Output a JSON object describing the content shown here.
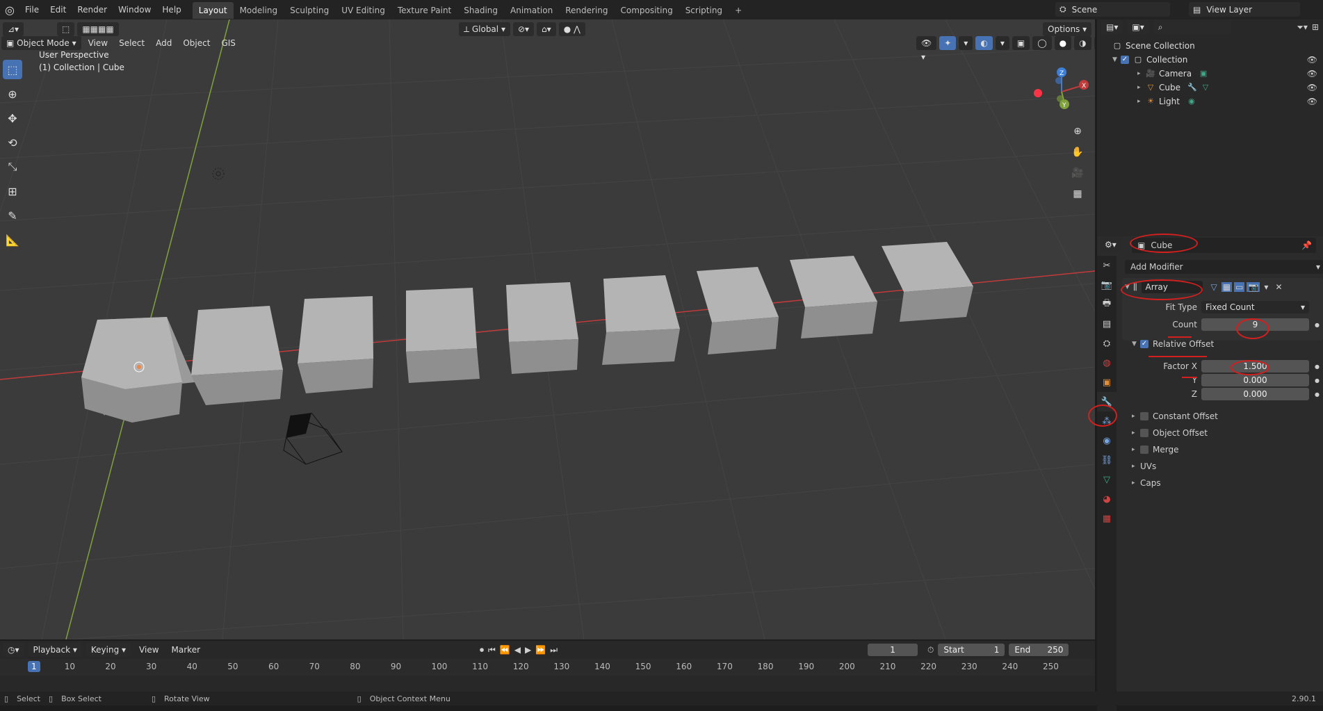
{
  "app": {
    "logo": "blender-logo-icon"
  },
  "menu": [
    "File",
    "Edit",
    "Render",
    "Window",
    "Help"
  ],
  "workspaces": [
    "Layout",
    "Modeling",
    "Sculpting",
    "UV Editing",
    "Texture Paint",
    "Shading",
    "Animation",
    "Rendering",
    "Compositing",
    "Scripting"
  ],
  "top": {
    "scene": "Scene",
    "view_layer": "View Layer"
  },
  "viewport": {
    "mode": "Object Mode",
    "menus": [
      "View",
      "Select",
      "Add",
      "Object",
      "GIS"
    ],
    "orientation": "Global",
    "options": "Options",
    "perspective": "User Perspective",
    "context": "(1) Collection | Cube",
    "gizmo": {
      "x": "X",
      "y": "Y",
      "z": "Z"
    }
  },
  "outliner": {
    "search_placeholder": "",
    "root": "Scene Collection",
    "collection": "Collection",
    "items": [
      "Camera",
      "Cube",
      "Light"
    ]
  },
  "properties": {
    "object_name": "Cube",
    "add_modifier": "Add Modifier",
    "modifier_name": "Array",
    "fit_type_label": "Fit Type",
    "fit_type_value": "Fixed Count",
    "count_label": "Count",
    "count_value": "9",
    "relative_offset": "Relative Offset",
    "factor_x_label": "Factor X",
    "factor_x": "1.500",
    "y_label": "Y",
    "factor_y": "0.000",
    "z_label": "Z",
    "factor_z": "0.000",
    "sections": [
      "Constant Offset",
      "Object Offset",
      "Merge",
      "UVs",
      "Caps"
    ]
  },
  "timeline": {
    "menus": [
      "Playback",
      "Keying",
      "View",
      "Marker"
    ],
    "current_frame": "1",
    "start_label": "Start",
    "start": "1",
    "end_label": "End",
    "end": "250",
    "ticks": [
      "1",
      "10",
      "20",
      "30",
      "40",
      "50",
      "60",
      "70",
      "80",
      "90",
      "100",
      "110",
      "120",
      "130",
      "140",
      "150",
      "160",
      "170",
      "180",
      "190",
      "200",
      "210",
      "220",
      "230",
      "240",
      "250"
    ]
  },
  "status": {
    "select": "Select",
    "box_select": "Box Select",
    "rotate": "Rotate View",
    "context_menu": "Object Context Menu",
    "version": "2.90.1"
  },
  "colors": {
    "accent": "#4772b3",
    "annotation": "#d41f1f",
    "x_axis": "#c23b3b",
    "y_axis": "#7fa33a"
  }
}
